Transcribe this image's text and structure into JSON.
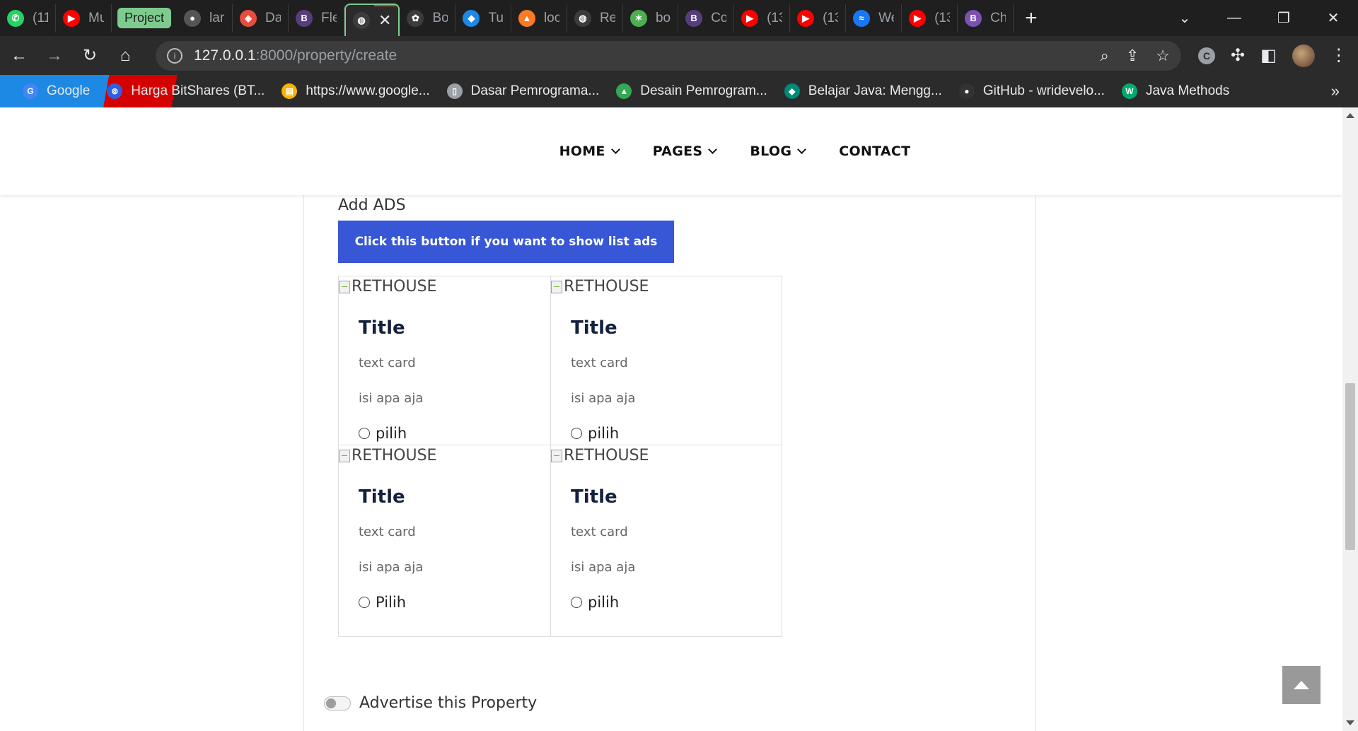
{
  "browser": {
    "tabs": [
      {
        "title": "(11",
        "icon": "whatsapp-icon",
        "color": "#25d366"
      },
      {
        "title": "Mu",
        "icon": "youtube-icon",
        "color": "#ff0000"
      },
      {
        "title": "Project",
        "group": true
      },
      {
        "title": "lara",
        "icon": "github-icon",
        "color": "#555555"
      },
      {
        "title": "Da",
        "icon": "laravel-icon",
        "color": "#e74c3c"
      },
      {
        "title": "Fle",
        "icon": "bootstrap-icon",
        "color": "#563d7c"
      },
      {
        "title": "",
        "icon": "globe-icon",
        "color": "#3c3c3c",
        "active": true
      },
      {
        "title": "Bo",
        "icon": "codeigniter-icon",
        "color": "#3c3c3c"
      },
      {
        "title": "Tu",
        "icon": "code-icon",
        "color": "#1e88e5"
      },
      {
        "title": "loc",
        "icon": "xampp-icon",
        "color": "#fb7a24"
      },
      {
        "title": "Re",
        "icon": "globe-icon",
        "color": "#3c3c3c"
      },
      {
        "title": "bo",
        "icon": "star-icon",
        "color": "#4caf50"
      },
      {
        "title": "Co",
        "icon": "bootstrap-icon",
        "color": "#563d7c"
      },
      {
        "title": "(13",
        "icon": "youtube-icon",
        "color": "#ff0000"
      },
      {
        "title": "(13",
        "icon": "youtube-icon",
        "color": "#ff0000"
      },
      {
        "title": "We",
        "icon": "messenger-icon",
        "color": "#1877f2"
      },
      {
        "title": "(13",
        "icon": "youtube-icon",
        "color": "#ff0000"
      },
      {
        "title": "Ch",
        "icon": "bootstrap-icon",
        "color": "#7952b3"
      }
    ],
    "new_tab": "+",
    "url_host": "127.0.0.1",
    "url_path": ":8000/property/create",
    "bookmarks": [
      {
        "label": "Google",
        "icon": "google-icon",
        "color": "#4285f4"
      },
      {
        "label": "Harga BitShares (BT...",
        "icon": "bitshares-icon",
        "color": "#2f5fe0"
      },
      {
        "label": "https://www.google...",
        "icon": "folder-icon",
        "color": "#f4b400"
      },
      {
        "label": "Dasar Pemrograma...",
        "icon": "book-icon",
        "color": "#9aa0a6"
      },
      {
        "label": "Desain Pemrogram...",
        "icon": "drive-icon",
        "color": "#34a853"
      },
      {
        "label": "Belajar Java: Mengg...",
        "icon": "petani-kode-icon",
        "color": "#00897b"
      },
      {
        "label": "GitHub - wridevelo...",
        "icon": "github-icon",
        "color": "#333333"
      },
      {
        "label": "Java Methods",
        "icon": "w3schools-icon",
        "color": "#04aa6d"
      }
    ],
    "bookmarks_more": "»"
  },
  "site": {
    "nav": [
      {
        "label": "HOME",
        "has_dropdown": true
      },
      {
        "label": "PAGES",
        "has_dropdown": true
      },
      {
        "label": "BLOG",
        "has_dropdown": true
      },
      {
        "label": "CONTACT",
        "has_dropdown": false
      }
    ]
  },
  "form": {
    "add_ads_label": "Add ADS",
    "show_ads_button": "Click this button if you want to show list ads",
    "cards": [
      {
        "img_alt": "RETHOUSE",
        "title": "Title",
        "text": "text card",
        "extra": "isi apa aja",
        "radio_label": "pilih"
      },
      {
        "img_alt": "RETHOUSE",
        "title": "Title",
        "text": "text card",
        "extra": "isi apa aja",
        "radio_label": "pilih"
      },
      {
        "img_alt": "RETHOUSE",
        "title": "Title",
        "text": "text card",
        "extra": "isi apa aja",
        "radio_label": "Pilih"
      },
      {
        "img_alt": "RETHOUSE",
        "title": "Title",
        "text": "text card",
        "extra": "isi apa aja",
        "radio_label": "pilih"
      }
    ],
    "advertise_toggle_label": "Advertise this Property"
  },
  "colors": {
    "accent_button": "#3757d6",
    "card_title": "#14213d",
    "tab_group": "#7ecb8e"
  }
}
